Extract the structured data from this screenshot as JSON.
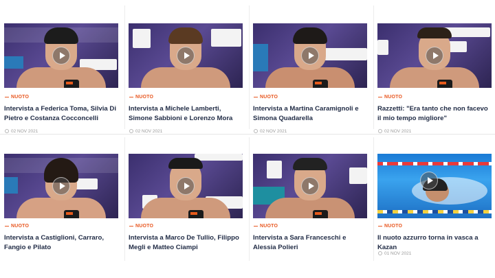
{
  "cards": [
    {
      "category": "NUOTO",
      "title": "Intervista a Federica Toma, Silvia Di Pietro e Costanza Cocconcelli",
      "date": "02 NOV 2021"
    },
    {
      "category": "NUOTO",
      "title": "Intervista a Michele Lamberti, Simone Sabbioni e Lorenzo Mora",
      "date": "02 NOV 2021"
    },
    {
      "category": "NUOTO",
      "title": "Intervista a Martina Caramignoli e Simona Quadarella",
      "date": "02 NOV 2021"
    },
    {
      "category": "NUOTO",
      "title": "Razzetti: \"Era tanto che non facevo il mio tempo migliore\"",
      "date": "02 NOV 2021"
    },
    {
      "category": "NUOTO",
      "title": "Intervista a Castiglioni, Carraro, Fangio e Pilato",
      "date": ""
    },
    {
      "category": "NUOTO",
      "title": "Intervista a Marco De Tullio, Filippo Megli e Matteo Ciampi",
      "date": ""
    },
    {
      "category": "NUOTO",
      "title": "Intervista a Sara Franceschi e Alessia Polieri",
      "date": ""
    },
    {
      "category": "NUOTO",
      "title": "Il nuoto azzurro torna in vasca a Kazan",
      "date": "01 NOV 2021"
    }
  ],
  "icons": {
    "play": "play-icon",
    "date": "calendar-icon"
  },
  "colors": {
    "category": "#e8561f",
    "title": "#1f2a44",
    "date": "#9a9a9a"
  }
}
